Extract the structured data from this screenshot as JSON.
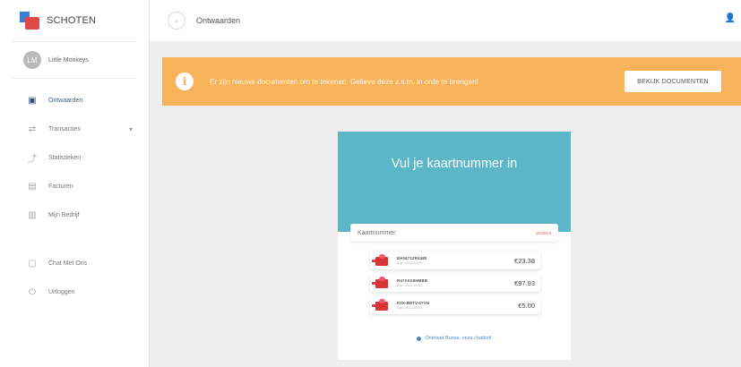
{
  "brand": {
    "name": "SCHOTEN"
  },
  "user": {
    "name": "Little Monkeys",
    "initials": "LM"
  },
  "sidebar": {
    "items": [
      {
        "label": "Ontwaarden",
        "icon": "wallet-icon"
      },
      {
        "label": "Transacties",
        "icon": "transactions-icon"
      },
      {
        "label": "Statistieken",
        "icon": "statistics-icon"
      },
      {
        "label": "Facturen",
        "icon": "invoice-icon"
      },
      {
        "label": "Mijn Bedrijf",
        "icon": "company-icon"
      },
      {
        "label": "Chat Met Ons",
        "icon": "chat-icon"
      },
      {
        "label": "Uitloggen",
        "icon": "power-icon"
      }
    ]
  },
  "header": {
    "title": "Ontwaarden"
  },
  "alert": {
    "text": "Er zijn nieuwe documenten om te tekenen. Gelieve deze z.s.m. in orde te brengen!",
    "button": "BEKIJK DOCUMENTEN"
  },
  "card": {
    "title": "Vul je kaartnummer in",
    "input_placeholder": "Kaartnummer",
    "input_hint": "Verplicht",
    "vouchers": [
      {
        "code": "EH0471ZR4480",
        "sub": "Exp. 2021-10-01",
        "amount": "€23.38"
      },
      {
        "code": "R47A0X9HMBB",
        "sub": "Exp. 2021-10-01",
        "amount": "€97.93"
      },
      {
        "code": "PZX-8MTV-07VN",
        "sub": "Exp. 2021-10-01",
        "amount": "€5.00"
      }
    ],
    "link": "Ontmoet Bunse, onze chatbot!"
  },
  "colors": {
    "accent": "#5bb7c8",
    "alert": "#f8b25a",
    "active_nav": "#2f4d7d"
  }
}
